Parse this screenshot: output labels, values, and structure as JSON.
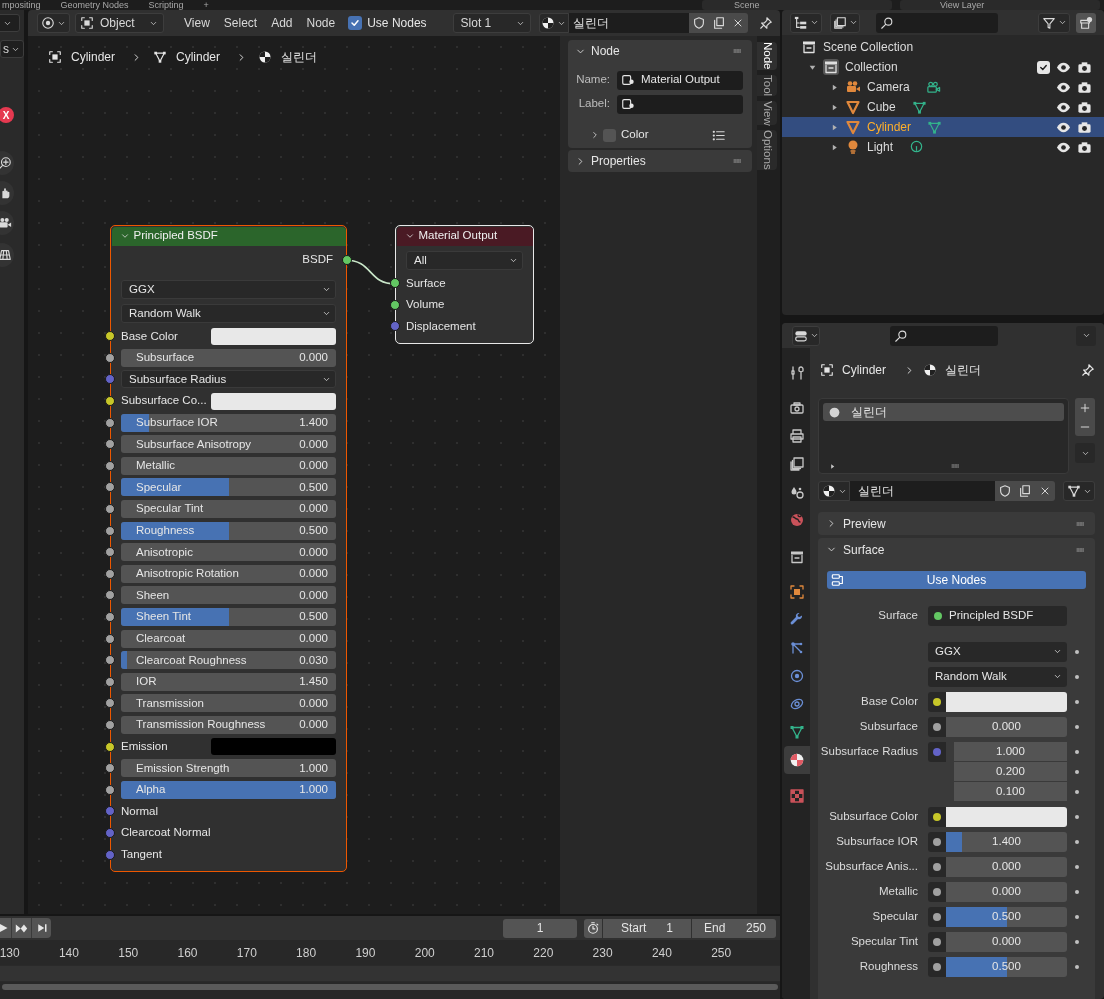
{
  "workspace_tabs": [
    "mpositing",
    "Geometry Nodes",
    "Scripting",
    "+"
  ],
  "scene_selector": "Scene",
  "view_layer_selector": "View Layer",
  "viewport": {
    "mode_dropdown": "s",
    "axis_label": "X"
  },
  "node_editor": {
    "header": {
      "mode": "Object",
      "menus": [
        "View",
        "Select",
        "Add",
        "Node"
      ],
      "use_nodes": {
        "label": "Use Nodes",
        "checked": true
      },
      "slot": "Slot 1",
      "material": "실린더"
    },
    "breadcrumb": [
      {
        "kind": "object",
        "label": "Cylinder"
      },
      {
        "kind": "mesh",
        "label": "Cylinder"
      },
      {
        "kind": "material",
        "label": "실린더"
      }
    ],
    "nodes": [
      {
        "title": "Principled BSDF",
        "color": "#2b652b",
        "selected": true,
        "active": false,
        "rows": [
          {
            "kind": "output",
            "label": "BSDF",
            "socket": {
              "color": "#63c763"
            }
          },
          {
            "kind": "dropdown",
            "value": "GGX"
          },
          {
            "kind": "dropdown",
            "value": "Random Walk"
          },
          {
            "kind": "color",
            "label": "Base Color",
            "socket": {
              "color": "#c7c729"
            },
            "swatch": {
              "color": "#e8e8e8"
            }
          },
          {
            "kind": "slider",
            "label": "Subsurface",
            "value": "0.000",
            "socket": {
              "color": "#a1a1a1"
            }
          },
          {
            "kind": "vector",
            "label": "Subsurface Radius",
            "socket": {
              "color": "#6363c7"
            }
          },
          {
            "kind": "color",
            "label": "Subsurface Co...",
            "socket": {
              "color": "#c7c729"
            },
            "swatch": {
              "color": "#e8e8e8"
            }
          },
          {
            "kind": "slider",
            "label": "Subsurface IOR",
            "value": "1.400",
            "level": 0.13,
            "socket": {
              "color": "#a1a1a1"
            }
          },
          {
            "kind": "slider",
            "label": "Subsurface Anisotropy",
            "value": "0.000",
            "socket": {
              "color": "#a1a1a1"
            }
          },
          {
            "kind": "slider",
            "label": "Metallic",
            "value": "0.000",
            "socket": {
              "color": "#a1a1a1"
            }
          },
          {
            "kind": "slider",
            "label": "Specular",
            "value": "0.500",
            "level": 0.5,
            "socket": {
              "color": "#a1a1a1"
            }
          },
          {
            "kind": "slider",
            "label": "Specular Tint",
            "value": "0.000",
            "socket": {
              "color": "#a1a1a1"
            }
          },
          {
            "kind": "slider",
            "label": "Roughness",
            "value": "0.500",
            "level": 0.5,
            "socket": {
              "color": "#a1a1a1"
            }
          },
          {
            "kind": "slider",
            "label": "Anisotropic",
            "value": "0.000",
            "socket": {
              "color": "#a1a1a1"
            }
          },
          {
            "kind": "slider",
            "label": "Anisotropic Rotation",
            "value": "0.000",
            "socket": {
              "color": "#a1a1a1"
            }
          },
          {
            "kind": "slider",
            "label": "Sheen",
            "value": "0.000",
            "socket": {
              "color": "#a1a1a1"
            }
          },
          {
            "kind": "slider",
            "label": "Sheen Tint",
            "value": "0.500",
            "level": 0.5,
            "socket": {
              "color": "#a1a1a1"
            }
          },
          {
            "kind": "slider",
            "label": "Clearcoat",
            "value": "0.000",
            "socket": {
              "color": "#a1a1a1"
            }
          },
          {
            "kind": "slider",
            "label": "Clearcoat Roughness",
            "value": "0.030",
            "level": 0.03,
            "socket": {
              "color": "#a1a1a1"
            }
          },
          {
            "kind": "slider",
            "label": "IOR",
            "value": "1.450",
            "socket": {
              "color": "#a1a1a1"
            }
          },
          {
            "kind": "slider",
            "label": "Transmission",
            "value": "0.000",
            "socket": {
              "color": "#a1a1a1"
            }
          },
          {
            "kind": "slider",
            "label": "Transmission Roughness",
            "value": "0.000",
            "socket": {
              "color": "#a1a1a1"
            }
          },
          {
            "kind": "color",
            "label": "Emission",
            "socket": {
              "color": "#c7c729"
            },
            "swatch": {
              "color": "#000000"
            }
          },
          {
            "kind": "slider",
            "label": "Emission Strength",
            "value": "1.000",
            "socket": {
              "color": "#a1a1a1"
            }
          },
          {
            "kind": "slider",
            "label": "Alpha",
            "value": "1.000",
            "level": 1,
            "socket": {
              "color": "#a1a1a1"
            }
          },
          {
            "kind": "input",
            "label": "Normal",
            "socket": {
              "color": "#6363c7"
            }
          },
          {
            "kind": "input",
            "label": "Clearcoat Normal",
            "socket": {
              "color": "#6363c7"
            }
          },
          {
            "kind": "input",
            "label": "Tangent",
            "socket": {
              "color": "#6363c7"
            }
          }
        ]
      },
      {
        "title": "Material Output",
        "color": "#4a1a24",
        "selected": true,
        "active": true,
        "rows": [
          {
            "kind": "dropdown",
            "value": "All"
          },
          {
            "kind": "input",
            "label": "Surface",
            "socket": {
              "color": "#63c763"
            }
          },
          {
            "kind": "input",
            "label": "Volume",
            "socket": {
              "color": "#63c763"
            }
          },
          {
            "kind": "input",
            "label": "Displacement",
            "socket": {
              "color": "#6363c7"
            }
          }
        ]
      }
    ]
  },
  "sidebar": {
    "node_panel": {
      "title": "Node",
      "expanded": true,
      "name_label": "Name:",
      "name": "Material Output",
      "label_label": "Label:",
      "color": {
        "label": "Color",
        "expanded": false,
        "enabled": false
      }
    },
    "properties_panel": {
      "title": "Properties",
      "expanded": false
    },
    "tabs": [
      {
        "label": "Node",
        "selected": true
      },
      {
        "label": "Tool",
        "selected": false
      },
      {
        "label": "View",
        "selected": false
      },
      {
        "label": "Options",
        "selected": false
      }
    ]
  },
  "outliner": {
    "items": [
      {
        "label": "Scene Collection",
        "kind": "scene_collection",
        "selected": false,
        "children": [
          {
            "label": "Collection",
            "kind": "collection",
            "selected": false,
            "expanded": true,
            "included": true,
            "children": [
              {
                "label": "Camera",
                "kind": "camera",
                "selected": false,
                "expanded": false
              },
              {
                "label": "Cube",
                "kind": "mesh",
                "selected": false,
                "expanded": false
              },
              {
                "label": "Cylinder",
                "kind": "mesh",
                "selected": true,
                "expanded": false
              },
              {
                "label": "Light",
                "kind": "light",
                "selected": false,
                "expanded": false
              }
            ]
          }
        ]
      }
    ]
  },
  "properties": {
    "tabs": [
      {
        "kind": "tool",
        "selected": false
      },
      {
        "kind": "render",
        "selected": false
      },
      {
        "kind": "output",
        "selected": false
      },
      {
        "kind": "view_layer",
        "selected": false
      },
      {
        "kind": "scene",
        "selected": false
      },
      {
        "kind": "world",
        "selected": false
      },
      {
        "kind": "collection",
        "selected": false
      },
      {
        "kind": "object",
        "selected": false
      },
      {
        "kind": "modifiers",
        "selected": false
      },
      {
        "kind": "particles",
        "selected": false
      },
      {
        "kind": "physics",
        "selected": false
      },
      {
        "kind": "constraints",
        "selected": false
      },
      {
        "kind": "data",
        "selected": false
      },
      {
        "kind": "material",
        "selected": true
      },
      {
        "kind": "texture",
        "selected": false
      }
    ],
    "breadcrumb": [
      {
        "kind": "object",
        "label": "Cylinder"
      },
      {
        "kind": "material",
        "label": "실린더"
      }
    ],
    "slots": [
      {
        "label": "실린더",
        "selected": true
      }
    ],
    "material": "실린더",
    "preview_panel": {
      "title": "Preview",
      "expanded": false
    },
    "surface_panel": {
      "title": "Surface",
      "expanded": true,
      "use_nodes_button": "Use Nodes",
      "rows": [
        {
          "kind": "link",
          "label": "Surface",
          "value": "Principled BSDF",
          "socket": {
            "color": "#63c763"
          }
        },
        {
          "kind": "dropdown",
          "value": "GGX"
        },
        {
          "kind": "dropdown",
          "value": "Random Walk"
        },
        {
          "kind": "color",
          "label": "Base Color",
          "socket": {
            "color": "#c7c729"
          },
          "swatch": {
            "color": "#e8e8e8"
          }
        },
        {
          "kind": "slider",
          "label": "Subsurface",
          "value": "0.000",
          "socket": {
            "color": "#a1a1a1"
          }
        },
        {
          "kind": "vector",
          "label": "Subsurface Radius",
          "socket": {
            "color": "#6363c7"
          },
          "values": [
            "1.000",
            "0.200",
            "0.100"
          ]
        },
        {
          "kind": "color",
          "label": "Subsurface Color",
          "socket": {
            "color": "#c7c729"
          },
          "swatch": {
            "color": "#e8e8e8"
          }
        },
        {
          "kind": "slider",
          "label": "Subsurface IOR",
          "value": "1.400",
          "level": 0.13,
          "socket": {
            "color": "#a1a1a1"
          }
        },
        {
          "kind": "slider",
          "label": "Subsurface Anis...",
          "value": "0.000",
          "socket": {
            "color": "#a1a1a1"
          }
        },
        {
          "kind": "slider",
          "label": "Metallic",
          "value": "0.000",
          "socket": {
            "color": "#a1a1a1"
          }
        },
        {
          "kind": "slider",
          "label": "Specular",
          "value": "0.500",
          "level": 0.5,
          "socket": {
            "color": "#a1a1a1"
          }
        },
        {
          "kind": "slider",
          "label": "Specular Tint",
          "value": "0.000",
          "socket": {
            "color": "#a1a1a1"
          }
        },
        {
          "kind": "slider",
          "label": "Roughness",
          "value": "0.500",
          "level": 0.5,
          "socket": {
            "color": "#a1a1a1"
          }
        }
      ]
    }
  },
  "timeline": {
    "current_frame": "1",
    "start_label": "Start",
    "start": "1",
    "end_label": "End",
    "end": "250",
    "ruler": [
      "130",
      "140",
      "150",
      "160",
      "170",
      "180",
      "190",
      "200",
      "210",
      "220",
      "230",
      "240",
      "250"
    ]
  }
}
